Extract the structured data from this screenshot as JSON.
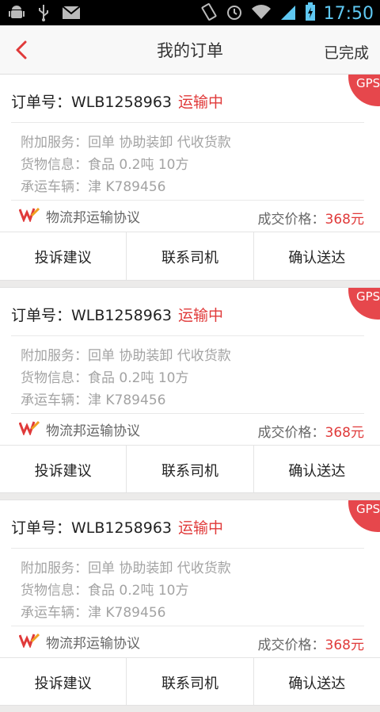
{
  "status_bar": {
    "time": "17:50"
  },
  "nav": {
    "title": "我的订单",
    "right_label": "已完成"
  },
  "colors": {
    "accent": "#e03a3a",
    "gps_badge": "#e6474c",
    "time": "#5fc8f2"
  },
  "orders": [
    {
      "gps": "GPS",
      "order_label": "订单号：WLB1258963",
      "status": "运输中",
      "services": "附加服务：回单  协助装卸  代收货款",
      "cargo": "货物信息：食品  0.2吨 10方",
      "vehicle": "承运车辆：津 K789456",
      "protocol": "物流邦运输协议",
      "price_label": "成交价格：",
      "price_value": "368元",
      "actions": [
        "投诉建议",
        "联系司机",
        "确认送达"
      ]
    },
    {
      "gps": "GPS",
      "order_label": "订单号：WLB1258963",
      "status": "运输中",
      "services": "附加服务：回单  协助装卸  代收货款",
      "cargo": "货物信息：食品  0.2吨 10方",
      "vehicle": "承运车辆：津 K789456",
      "protocol": "物流邦运输协议",
      "price_label": "成交价格：",
      "price_value": "368元",
      "actions": [
        "投诉建议",
        "联系司机",
        "确认送达"
      ]
    },
    {
      "gps": "GPS",
      "order_label": "订单号：WLB1258963",
      "status": "运输中",
      "services": "附加服务：回单  协助装卸  代收货款",
      "cargo": "货物信息：食品  0.2吨 10方",
      "vehicle": "承运车辆：津 K789456",
      "protocol": "物流邦运输协议",
      "price_label": "成交价格：",
      "price_value": "368元",
      "actions": [
        "投诉建议",
        "联系司机",
        "确认送达"
      ]
    }
  ]
}
